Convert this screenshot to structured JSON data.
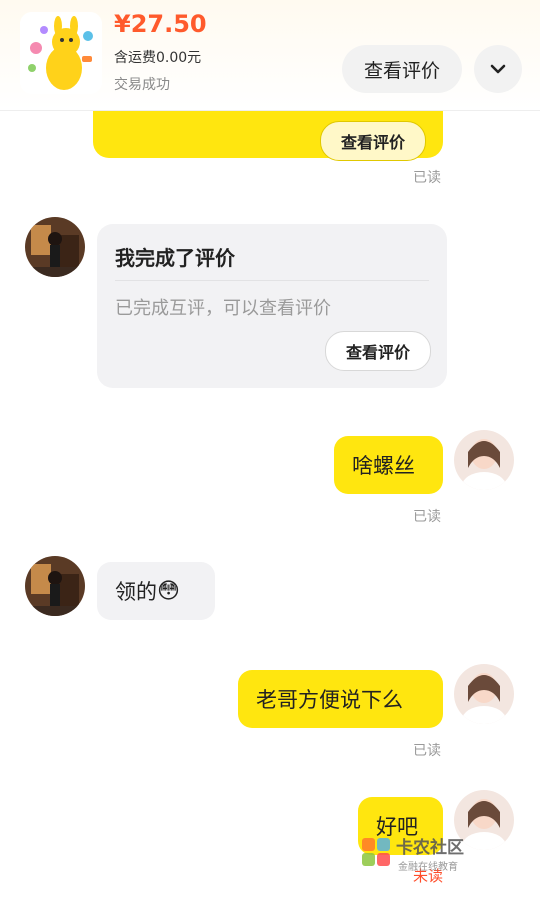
{
  "header": {
    "price": "¥27.50",
    "shipping": "含运费0.00元",
    "status": "交易成功",
    "view_review_label": "查看评价",
    "chevron_icon": "chevron-down-icon",
    "product_icon": "mascot-product-thumbnail"
  },
  "messages": {
    "top_card_button": "查看评价",
    "top_card_read": "已读",
    "review_card": {
      "title": "我完成了评价",
      "subtitle": "已完成互评，可以查看评价",
      "button": "查看评价"
    },
    "msg1": {
      "text": "啥螺丝",
      "read": "已读"
    },
    "msg2": {
      "text": "领的",
      "emoji": "😳"
    },
    "msg3": {
      "text": "老哥方便说下么",
      "read": "已读"
    },
    "msg4": {
      "text": "好吧",
      "status": "未读"
    }
  },
  "watermark": {
    "title": "卡农社区",
    "subtitle": "金融在线教育"
  },
  "colors": {
    "accent_yellow": "#ffe60f",
    "price_red": "#ff5a2c",
    "unread_red": "#ff4d2a"
  }
}
